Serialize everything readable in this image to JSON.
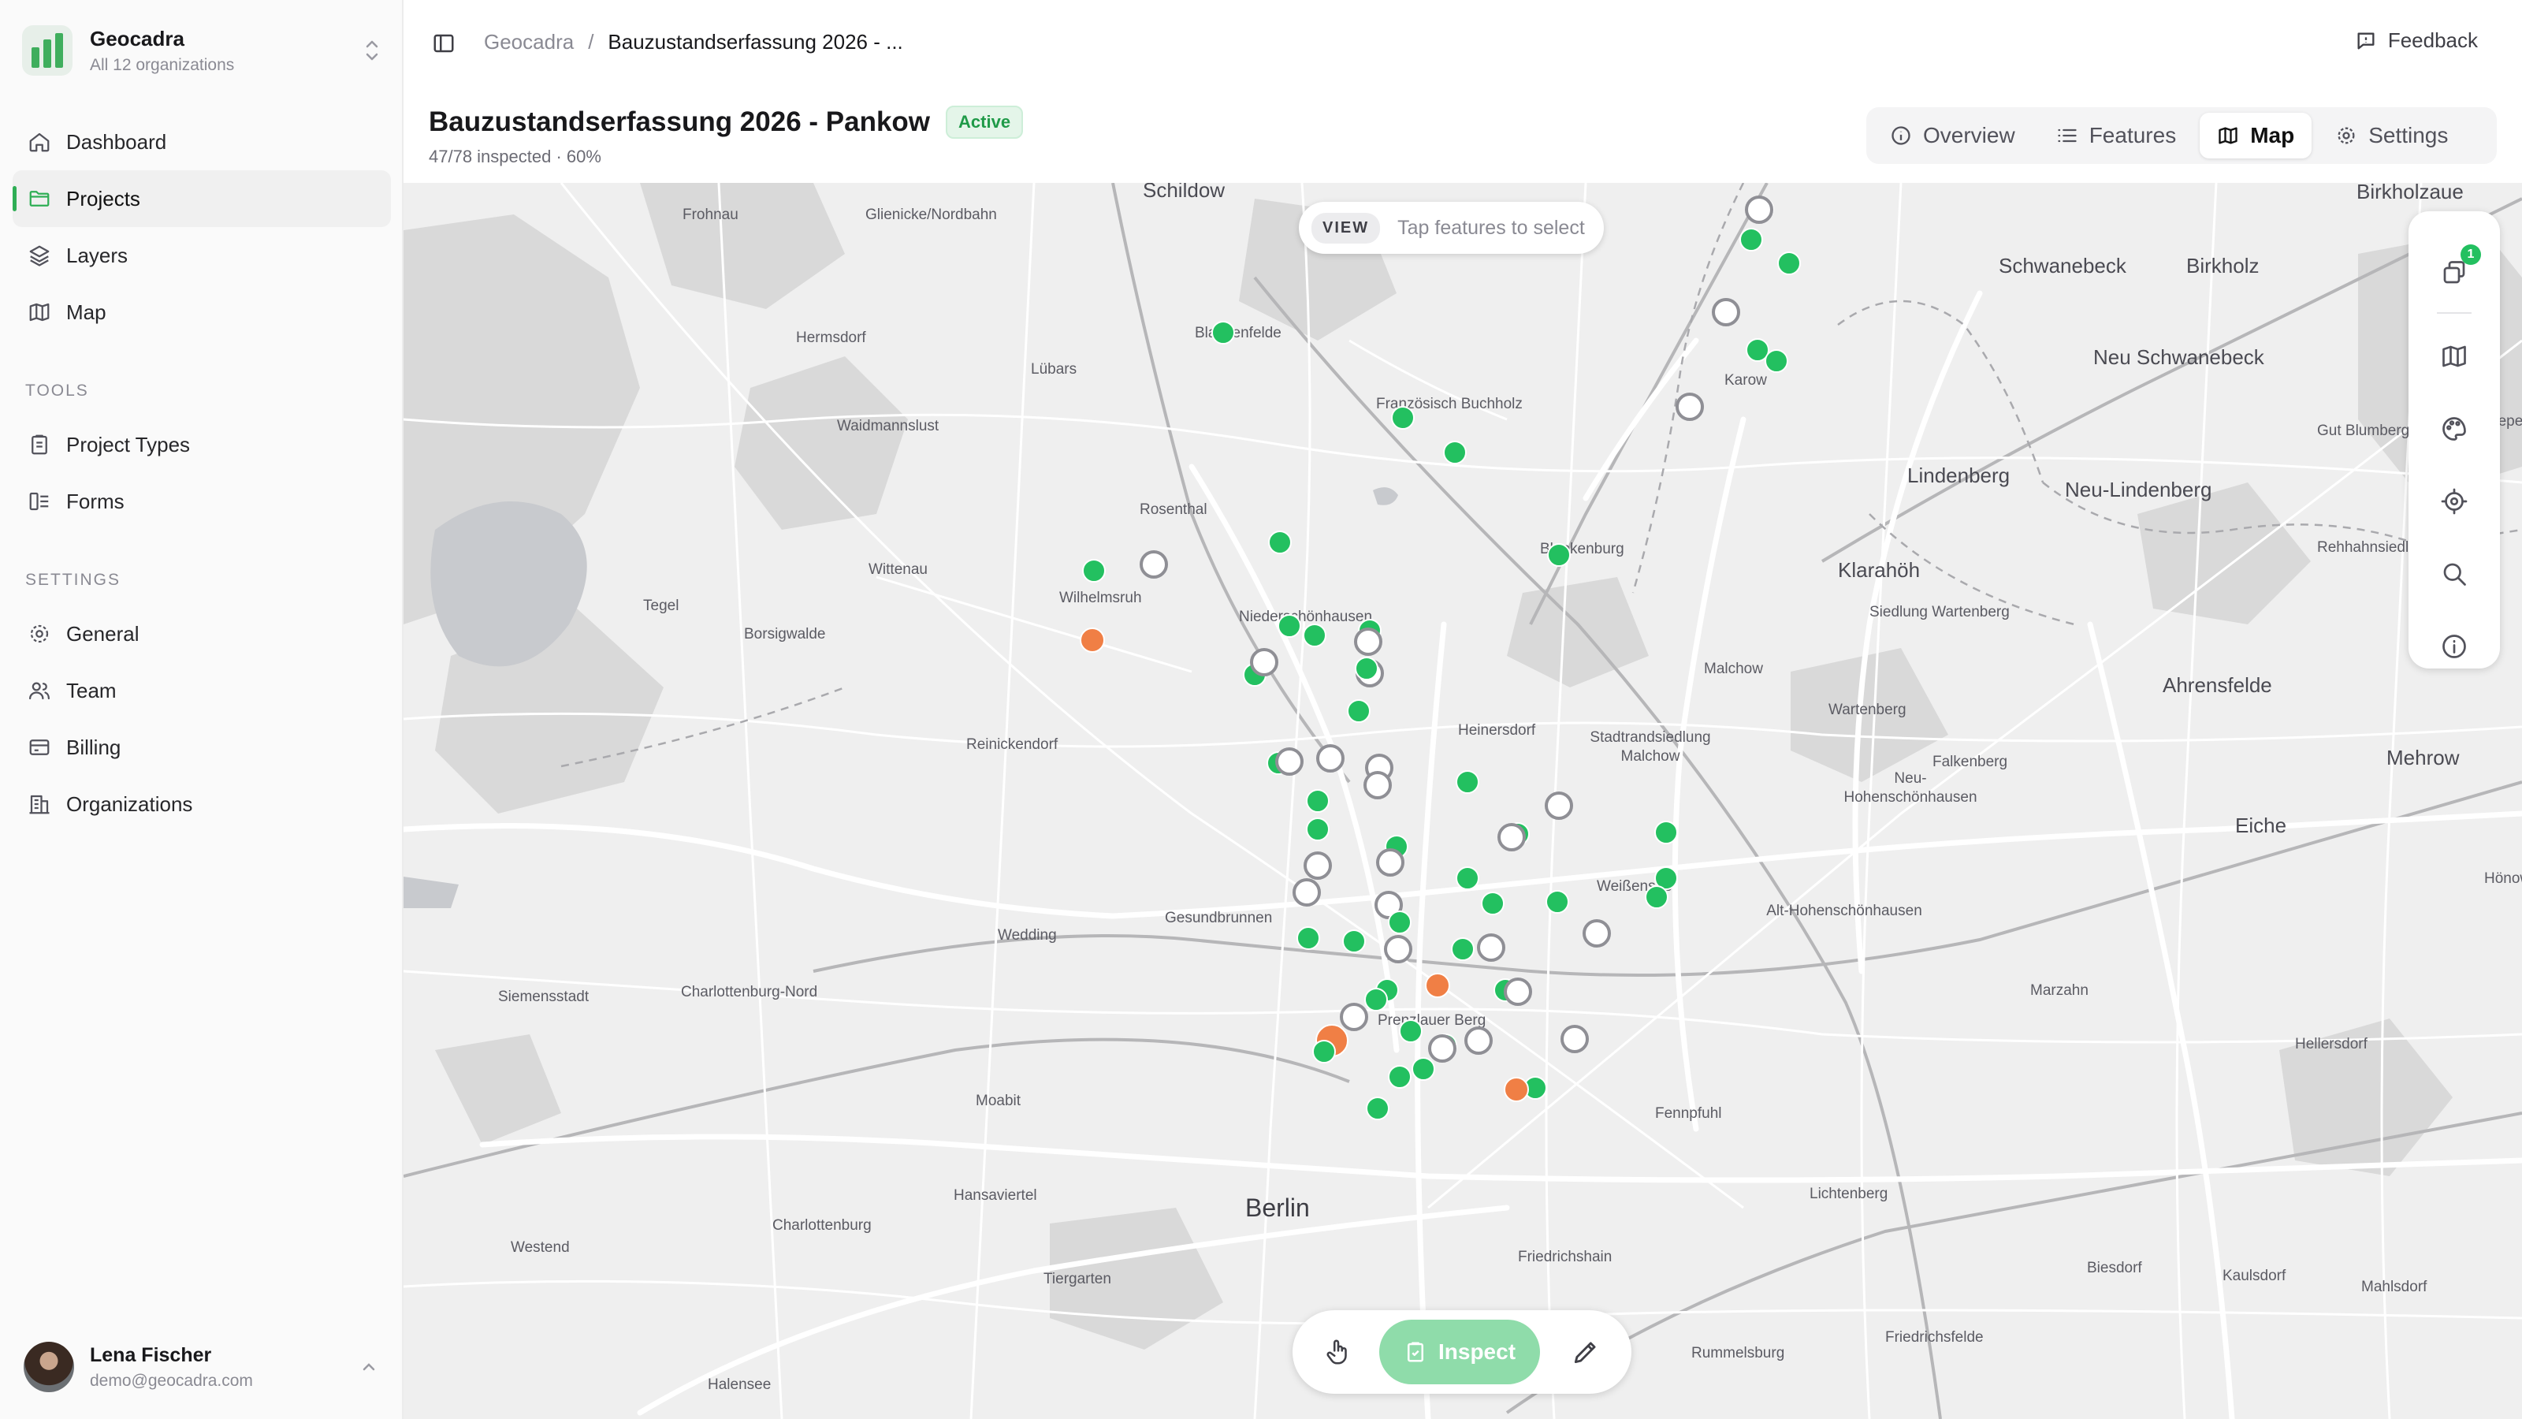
{
  "sidebar": {
    "org": {
      "name": "Geocadra",
      "sub": "All 12 organizations"
    },
    "nav": [
      {
        "label": "Dashboard",
        "icon": "home-icon"
      },
      {
        "label": "Projects",
        "icon": "folder-icon"
      },
      {
        "label": "Layers",
        "icon": "layers-icon"
      },
      {
        "label": "Map",
        "icon": "map-icon"
      }
    ],
    "tools_heading": "TOOLS",
    "tools": [
      {
        "label": "Project Types",
        "icon": "clipboard-icon"
      },
      {
        "label": "Forms",
        "icon": "form-icon"
      }
    ],
    "settings_heading": "SETTINGS",
    "settings": [
      {
        "label": "General",
        "icon": "gear-icon"
      },
      {
        "label": "Team",
        "icon": "team-icon"
      },
      {
        "label": "Billing",
        "icon": "card-icon"
      },
      {
        "label": "Organizations",
        "icon": "building-icon"
      }
    ],
    "user": {
      "name": "Lena Fischer",
      "email": "demo@geocadra.com"
    }
  },
  "header": {
    "breadcrumb": [
      "Geocadra",
      "/",
      "Bauzustandserfassung 2026 - ..."
    ],
    "feedback": "Feedback",
    "title": "Bauzustandserfassung 2026 - Pankow",
    "status": "Active",
    "progress_text": "47/78 inspected · 60%",
    "tabs": [
      {
        "label": "Overview",
        "icon": "info-icon"
      },
      {
        "label": "Features",
        "icon": "list-icon"
      },
      {
        "label": "Map",
        "icon": "map-icon"
      },
      {
        "label": "Settings",
        "icon": "gear-icon"
      }
    ],
    "active_tab": "Map"
  },
  "map": {
    "view_tag": "VIEW",
    "view_hint": "Tap features to select",
    "layer_count": "1",
    "inspect_label": "Inspect",
    "places": [
      "Schildow",
      "Frohnau",
      "Glienicke/Nordbahn",
      "Hermsdorf",
      "Lübars",
      "Waidmannslust",
      "Blankenfelde",
      "Französisch Buchholz",
      "Karow",
      "Schwanebeck",
      "Birkholz",
      "Neu Schwanebeck",
      "Birkholzaue",
      "Lindenberg",
      "Neu-Lindenberg",
      "Gut Blumberg",
      "Rosenthal",
      "Wittenau",
      "Wilhelmsruh",
      "Niederschönhausen",
      "Blankenburg",
      "Klarahöh",
      "Siedlung Wartenberg",
      "Rehhahnsiedlung",
      "Tegel",
      "Borsigwalde",
      "Malchow",
      "Wartenberg",
      "Ahrensfelde",
      "Reinickendorf",
      "Heinersdorf",
      "Stadtrandsiedlung Malchow",
      "Neu-Hohenschönhausen",
      "Falkenberg",
      "Mehrow",
      "Eiche",
      "Weißensee",
      "Alt-Hohenschönhausen",
      "Wedding",
      "Gesundbrunnen",
      "Siemensstadt",
      "Charlottenburg-Nord",
      "Marzahn",
      "Hellersdorf",
      "Prenzlauer Berg",
      "Moabit",
      "Fennpfuhl",
      "Hansaviertel",
      "Charlottenburg",
      "Berlin",
      "Lichtenberg",
      "Westend",
      "Tiergarten",
      "Friedrichshain",
      "Biesdorf",
      "Kaulsdorf",
      "Mahlsdorf",
      "Rummelsburg",
      "Friedrichsfelde",
      "Halensee",
      "Hönow",
      "Zepernick"
    ],
    "legend_colors": {
      "inspected": "#23c060",
      "pending": "#ffffff",
      "issue": "#f07f45"
    }
  }
}
